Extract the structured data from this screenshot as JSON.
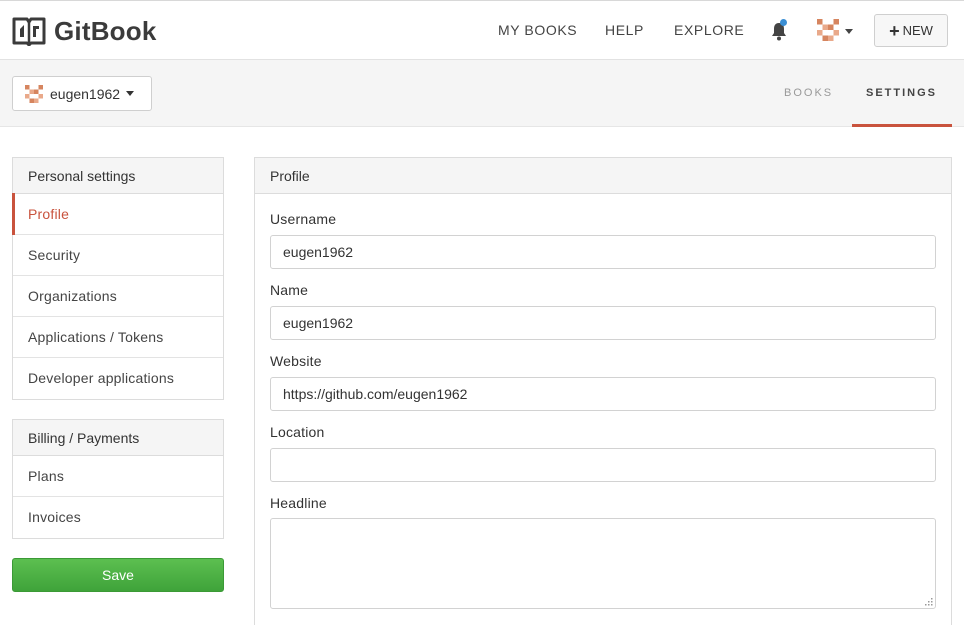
{
  "brand": {
    "name": "GitBook"
  },
  "topnav": {
    "links": [
      "MY BOOKS",
      "HELP",
      "EXPLORE"
    ],
    "new_label": "NEW"
  },
  "user": {
    "username": "eugen1962"
  },
  "subtabs": {
    "books": "BOOKS",
    "settings": "SETTINGS",
    "active": "SETTINGS"
  },
  "sidebar": {
    "personal_heading": "Personal settings",
    "personal_items": [
      "Profile",
      "Security",
      "Organizations",
      "Applications / Tokens",
      "Developer applications"
    ],
    "active_item": "Profile",
    "billing_heading": "Billing / Payments",
    "billing_items": [
      "Plans",
      "Invoices"
    ],
    "save_label": "Save"
  },
  "profile": {
    "heading": "Profile",
    "username_label": "Username",
    "username_value": "eugen1962",
    "name_label": "Name",
    "name_value": "eugen1962",
    "website_label": "Website",
    "website_value": "https://github.com/eugen1962",
    "location_label": "Location",
    "location_value": "",
    "headline_label": "Headline",
    "headline_value": ""
  },
  "colors": {
    "accent": "#c9533d",
    "save_green": "#4cb147",
    "notification_dot": "#3b8fd4"
  },
  "icons": [
    "gitbook-logo-icon",
    "bell-icon",
    "avatar-icon",
    "caret-down-icon",
    "plus-icon",
    "resize-grip-icon"
  ]
}
